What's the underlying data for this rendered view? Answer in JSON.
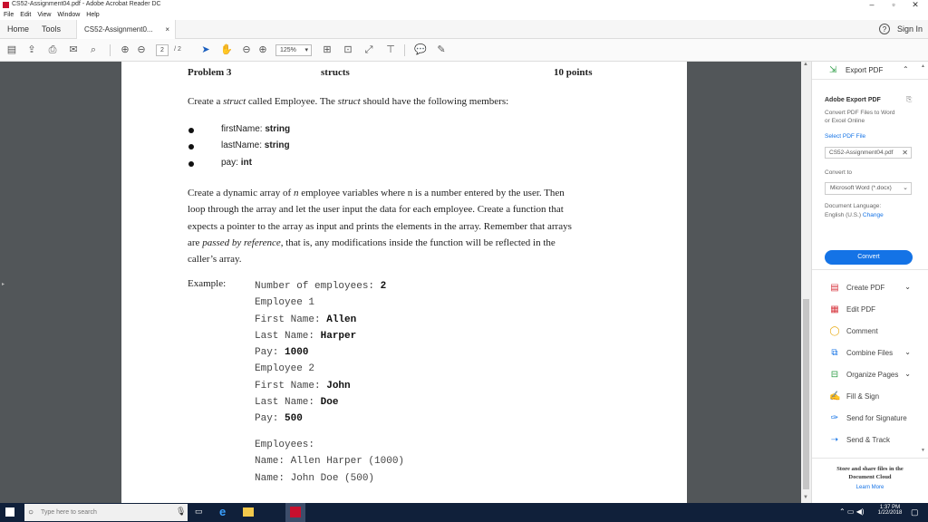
{
  "window": {
    "title": "CS52-Assignment04.pdf - Adobe Acrobat Reader DC",
    "minimize": "–",
    "maximize": "▫",
    "close": "✕"
  },
  "menu": [
    "File",
    "Edit",
    "View",
    "Window",
    "Help"
  ],
  "tabs": {
    "home": "Home",
    "tools": "Tools",
    "doc": "CS52-Assignment0...",
    "doc_close": "×",
    "signin": "Sign In",
    "help": "?"
  },
  "toolbar": {
    "page_current": "2",
    "page_total": "/ 2",
    "zoom": "125%"
  },
  "document": {
    "header_left": "Problem 3",
    "header_center": "structs",
    "header_right": "10 points",
    "intro_1": "Create a ",
    "intro_struct1": "struct",
    "intro_2": " called Employee. The ",
    "intro_struct2": "struct",
    "intro_3": " should have the following members:",
    "members": [
      {
        "name": "firstName: ",
        "type": "string"
      },
      {
        "name": "lastName: ",
        "type": "string"
      },
      {
        "name": "pay: ",
        "type": "int"
      }
    ],
    "para_lines": [
      "Create a dynamic array of n employee variables where n is a number entered by the user. Then",
      "loop through the array and let the user input the data for each employee. Create a function that",
      "expects a pointer to the array as input and prints the elements in the array. Remember that arrays",
      "are passed by reference, that is, any modifications inside the function will be reflected in the",
      "caller’s array."
    ],
    "example_label": "Example:",
    "example": [
      {
        "label": "Number of employees: ",
        "value": "2"
      },
      {
        "label": "Employee 1",
        "value": ""
      },
      {
        "label": "First Name: ",
        "value": "Allen"
      },
      {
        "label": "Last Name: ",
        "value": "Harper"
      },
      {
        "label": "Pay: ",
        "value": "1000"
      },
      {
        "label": "Employee 2",
        "value": ""
      },
      {
        "label": "First Name: ",
        "value": "John"
      },
      {
        "label": "Last Name: ",
        "value": "Doe"
      },
      {
        "label": "Pay: ",
        "value": "500"
      }
    ],
    "output": [
      "Employees:",
      "Name: Allen Harper (1000)",
      "Name: John Doe (500)"
    ]
  },
  "rightpane": {
    "export_pdf": "Export PDF",
    "adobe_export_title": "Adobe Export PDF",
    "adobe_export_desc_1": "Convert PDF Files to Word",
    "adobe_export_desc_2": "or Excel Online",
    "select_file": "Select PDF File",
    "file_name": "CS52-Assignment04.pdf",
    "convert_to": "Convert to",
    "format": "Microsoft Word (*.docx)",
    "doc_lang_label": "Document Language:",
    "doc_lang_value": "English (U.S.)",
    "doc_lang_change": "Change",
    "convert_button": "Convert",
    "tools": [
      {
        "label": "Create PDF",
        "icon": "create-pdf-icon",
        "chevron": true
      },
      {
        "label": "Edit PDF",
        "icon": "edit-pdf-icon",
        "chevron": false
      },
      {
        "label": "Comment",
        "icon": "comment-icon",
        "chevron": false
      },
      {
        "label": "Combine Files",
        "icon": "combine-files-icon",
        "chevron": true
      },
      {
        "label": "Organize Pages",
        "icon": "organize-pages-icon",
        "chevron": true
      },
      {
        "label": "Fill & Sign",
        "icon": "fill-sign-icon",
        "chevron": false
      },
      {
        "label": "Send for Signature",
        "icon": "send-signature-icon",
        "chevron": false
      },
      {
        "label": "Send & Track",
        "icon": "send-track-icon",
        "chevron": false
      }
    ],
    "store_line1": "Store and share files in the",
    "store_line2": "Document Cloud",
    "learn_more": "Learn More"
  },
  "taskbar": {
    "search_placeholder": "Type here to search",
    "time": "1:37 PM",
    "date": "1/22/2018"
  },
  "colors": {
    "accent_blue": "#1473e6",
    "taskbar": "#10203a",
    "doc_background": "#525659",
    "pdf_red": "#c8102e"
  }
}
